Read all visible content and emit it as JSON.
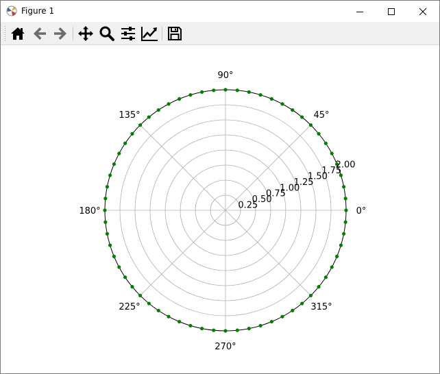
{
  "window": {
    "title": "Figure 1",
    "minimize_glyph": "minimize",
    "maximize_glyph": "maximize",
    "close_glyph": "close"
  },
  "toolbar": {
    "icons": [
      "home-icon",
      "back-arrow-icon",
      "forward-arrow-icon",
      "pan-icon",
      "zoom-icon",
      "configure-subplots-icon",
      "edit-axis-icon",
      "save-icon"
    ]
  },
  "colors": {
    "marker": "#008000",
    "grid": "#b0b0b0",
    "spine": "#000000",
    "toolbar_bg": "#f0f0f0"
  },
  "chart_data": {
    "type": "scatter",
    "projection": "polar",
    "title": "",
    "rmax": 2.0,
    "r_ticks": [
      "0.25",
      "0.50",
      "0.75",
      "1.00",
      "1.25",
      "1.50",
      "1.75",
      "2.00"
    ],
    "r_tick_values": [
      0.25,
      0.5,
      0.75,
      1.0,
      1.25,
      1.5,
      1.75,
      2.0
    ],
    "theta_tick_labels": [
      "0°",
      "45°",
      "90°",
      "135°",
      "180°",
      "225°",
      "270°",
      "315°"
    ],
    "theta_tick_degrees": [
      0,
      45,
      90,
      135,
      180,
      225,
      270,
      315
    ],
    "grid": true,
    "series": [
      {
        "marker": "o",
        "color": "#008000",
        "r_constant": 2.0,
        "point_count": 64,
        "theta_start_degrees": 0,
        "theta_end_degrees": 354.375
      }
    ]
  }
}
